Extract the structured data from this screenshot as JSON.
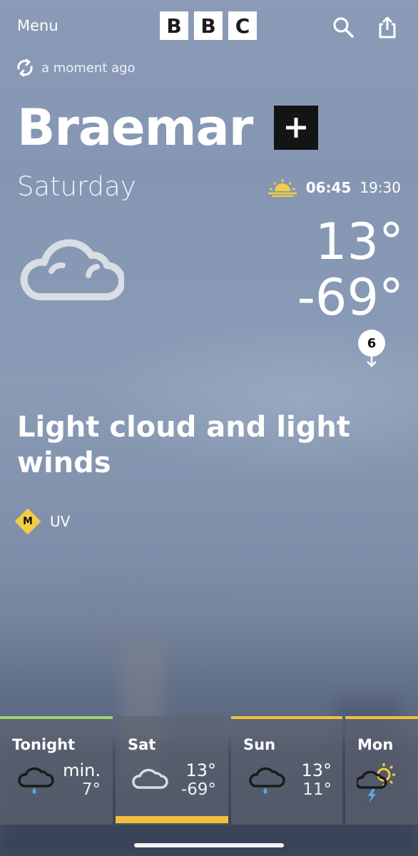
{
  "header": {
    "menu_label": "Menu",
    "logo_letters": [
      "B",
      "B",
      "C"
    ],
    "search_icon": "search-icon",
    "share_icon": "share-icon"
  },
  "updated": {
    "icon": "refresh-icon",
    "text": "a moment ago"
  },
  "location": {
    "name": "Braemar",
    "add_icon": "plus-icon"
  },
  "today": {
    "day": "Saturday",
    "sunrise_icon": "sunrise-icon",
    "sunrise": "06:45",
    "sunset": "19:30",
    "weather_icon": "light-cloud-icon",
    "max_temp": "13°",
    "min_temp": "-69°",
    "wind_speed": "6",
    "summary": "Light cloud and light winds",
    "uv_level": "M",
    "uv_label": "UV"
  },
  "forecast": [
    {
      "name": "Tonight",
      "icon": "light-rain-cloud-icon",
      "hi": "min.",
      "lo": "7°",
      "accent": "#9fd36b"
    },
    {
      "name": "Sat",
      "icon": "light-cloud-icon",
      "hi": "13°",
      "lo": "-69°",
      "accent": "",
      "selected": true
    },
    {
      "name": "Sun",
      "icon": "light-rain-cloud-icon",
      "hi": "13°",
      "lo": "11°",
      "accent": "#f2c03c"
    },
    {
      "name": "Mon",
      "icon": "thundery-showers-sun-icon",
      "hi": "",
      "lo": "",
      "accent": "#f2c03c"
    }
  ],
  "colors": {
    "selected_underline": "#f2c03c",
    "tonight_accent": "#9fd36b",
    "uv_moderate": "#f4cd44",
    "rain_drop": "#5ea8e6",
    "sun_yellow": "#f4cd44"
  }
}
